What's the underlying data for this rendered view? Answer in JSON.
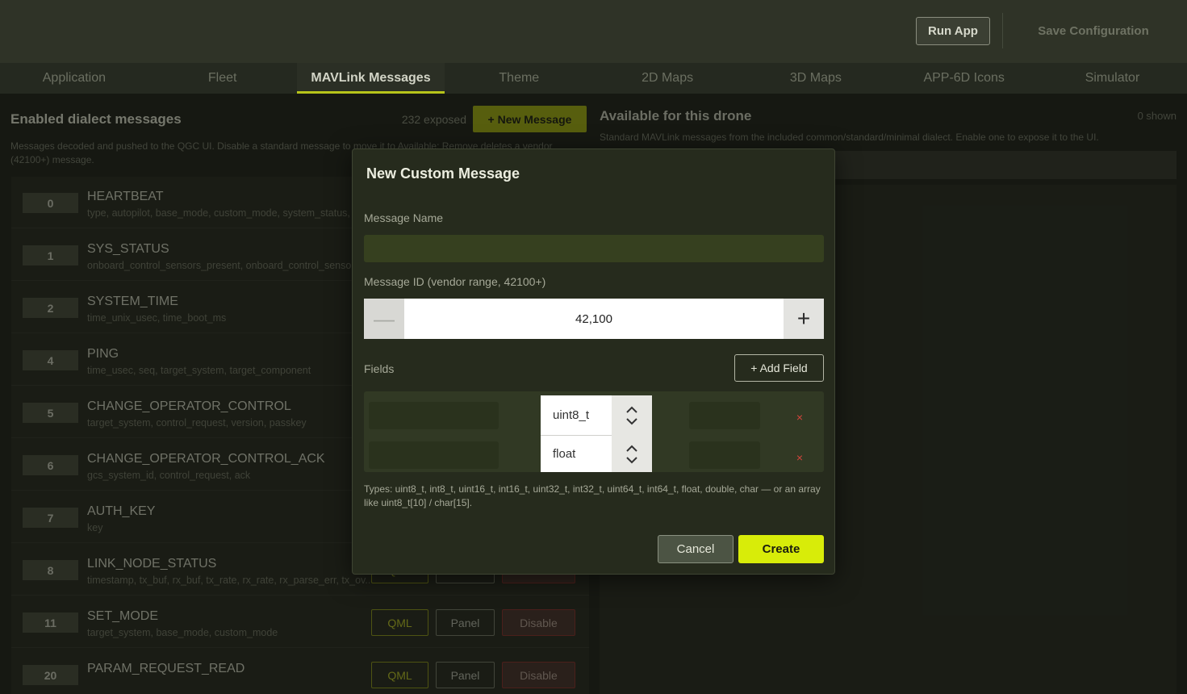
{
  "header": {
    "run_label": "Run App",
    "save_label": "Save Configuration"
  },
  "tabs": [
    {
      "label": "Application"
    },
    {
      "label": "Fleet"
    },
    {
      "label": "MAVLink Messages"
    },
    {
      "label": "Theme"
    },
    {
      "label": "2D Maps"
    },
    {
      "label": "3D Maps"
    },
    {
      "label": "APP-6D Icons"
    },
    {
      "label": "Simulator"
    }
  ],
  "active_tab": "MAVLink Messages",
  "left": {
    "title": "Enabled dialect messages",
    "exposed": "232 exposed",
    "new_message_label": "+ New Message",
    "description": "Messages decoded and pushed to the QGC UI. Disable a standard message to move it to Available; Remove deletes a vendor (42100+) message.",
    "qml_label": "QML",
    "panel_label": "Panel",
    "disable_label": "Disable",
    "messages": [
      {
        "id": "0",
        "name": "HEARTBEAT",
        "fields": "type, autopilot, base_mode, custom_mode, system_status, m"
      },
      {
        "id": "1",
        "name": "SYS_STATUS",
        "fields": "onboard_control_sensors_present, onboard_control_sensors"
      },
      {
        "id": "2",
        "name": "SYSTEM_TIME",
        "fields": "time_unix_usec, time_boot_ms"
      },
      {
        "id": "4",
        "name": "PING",
        "fields": "time_usec, seq, target_system, target_component"
      },
      {
        "id": "5",
        "name": "CHANGE_OPERATOR_CONTROL",
        "fields": "target_system, control_request, version, passkey"
      },
      {
        "id": "6",
        "name": "CHANGE_OPERATOR_CONTROL_ACK",
        "fields": "gcs_system_id, control_request, ack"
      },
      {
        "id": "7",
        "name": "AUTH_KEY",
        "fields": "key"
      },
      {
        "id": "8",
        "name": "LINK_NODE_STATUS",
        "fields": "timestamp, tx_buf, rx_buf, tx_rate, rx_rate, rx_parse_err, tx_ov..."
      },
      {
        "id": "11",
        "name": "SET_MODE",
        "fields": "target_system, base_mode, custom_mode"
      },
      {
        "id": "20",
        "name": "PARAM_REQUEST_READ",
        "fields": ""
      }
    ]
  },
  "right": {
    "title": "Available for this drone",
    "shown": "0 shown",
    "description": "Standard MAVLink messages from the included common/standard/minimal dialect. Enable one to expose it to the UI."
  },
  "modal": {
    "title": "New Custom Message",
    "name_label": "Message Name",
    "name_value": "",
    "id_label": "Message ID (vendor range, 42100+)",
    "id_value": "42,100",
    "minus_glyph": "—",
    "plus_glyph": "+",
    "fields_label": "Fields",
    "add_field_label": "+ Add Field",
    "fields": [
      {
        "type": "uint8_t",
        "remove_glyph": "×"
      },
      {
        "type": "float",
        "remove_glyph": "×"
      }
    ],
    "types_hint": "Types: uint8_t, int8_t, uint16_t, int16_t, uint32_t, int32_t, uint64_t, int64_t, float, double, char — or an array like uint8_t[10] / char[15].",
    "cancel_label": "Cancel",
    "create_label": "Create"
  },
  "colors": {
    "accent": "#d8ec09",
    "tab_underline": "#b7c41a",
    "danger": "#d2443c"
  }
}
